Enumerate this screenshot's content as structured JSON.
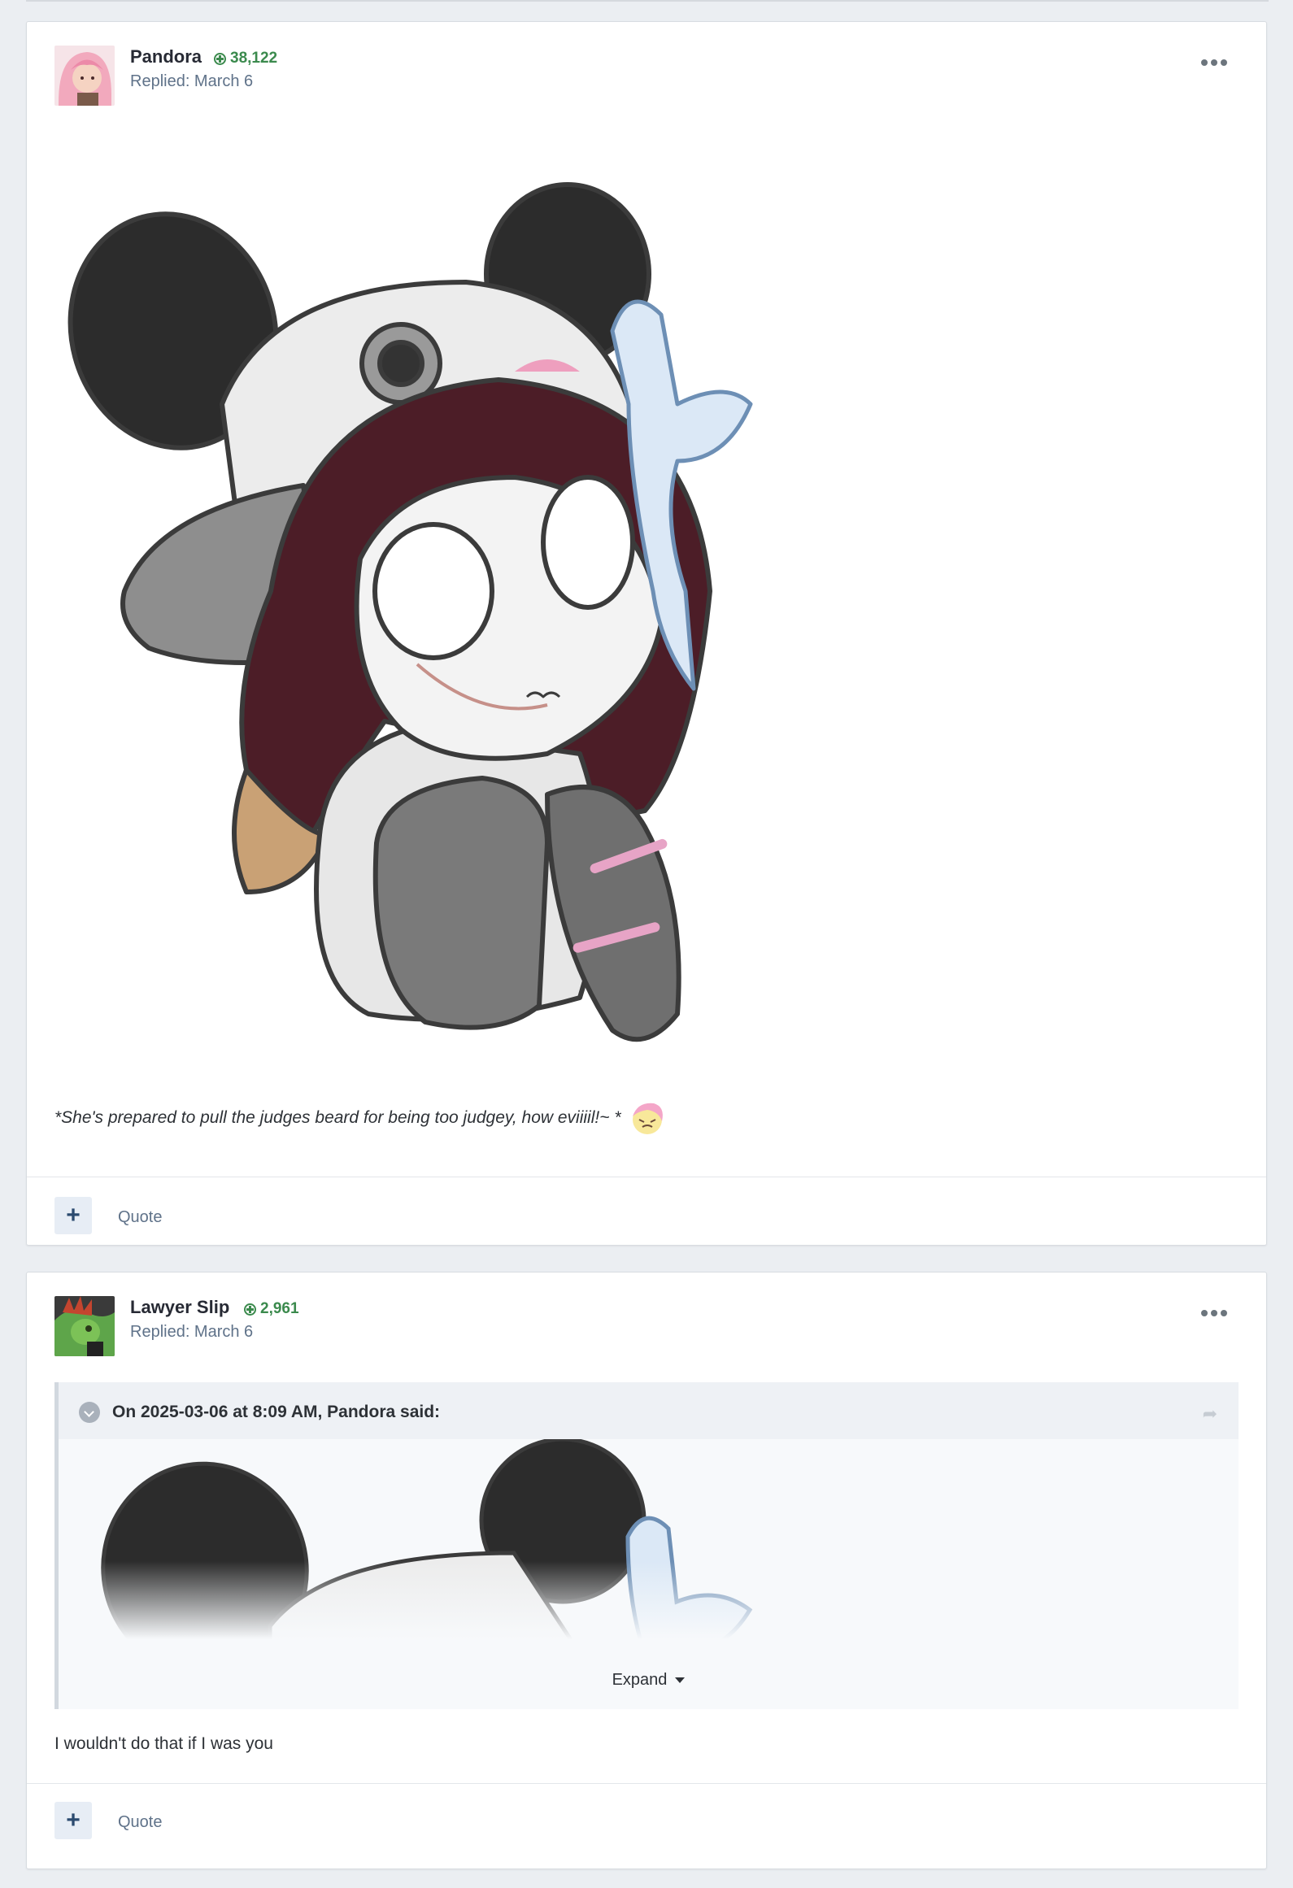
{
  "posts": [
    {
      "author": "Pandora",
      "reputation": "38,122",
      "replied": "Replied: March 6",
      "caption": "*She's prepared to pull the judges beard for being too judgey, how eviiiil!~ *",
      "quote_label": "Quote",
      "plus_label": "+",
      "emoji_icon": "fluttershy-emoji-icon"
    },
    {
      "author": "Lawyer Slip",
      "reputation": "2,961",
      "replied": "Replied: March 6",
      "quote_cite": "On 2025-03-06 at 8:09 AM, Pandora said:",
      "expand_label": "Expand",
      "body": "I wouldn't do that if I was you",
      "quote_label": "Quote",
      "plus_label": "+"
    }
  ],
  "colors": {
    "reputation": "#3b8a4d",
    "meta": "#5f7289",
    "button_bg": "#e7edf5"
  }
}
